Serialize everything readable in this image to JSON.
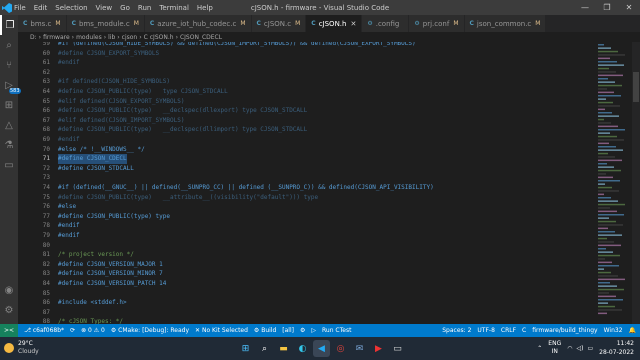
{
  "window": {
    "title": "cJSON.h - firmware - Visual Studio Code",
    "menu": [
      "File",
      "Edit",
      "Selection",
      "View",
      "Go",
      "Run",
      "Terminal",
      "Help"
    ],
    "controls": [
      "—",
      "❐",
      "✕"
    ]
  },
  "tabs": [
    {
      "label": "bms.c",
      "modified": "M",
      "icon": "C"
    },
    {
      "label": "bms_module.c",
      "modified": "M",
      "icon": "C"
    },
    {
      "label": "azure_iot_hub_codec.c",
      "modified": "M",
      "icon": "C"
    },
    {
      "label": "cJSON.c",
      "modified": "M",
      "icon": "C"
    },
    {
      "label": "cJSON.h",
      "modified": "✕",
      "icon": "C"
    },
    {
      "label": ".config",
      "modified": "",
      "icon": "⚙"
    },
    {
      "label": "prj.conf",
      "modified": "M",
      "icon": "⚙"
    },
    {
      "label": "json_common.c",
      "modified": "M",
      "icon": "C"
    }
  ],
  "breadcrumb": [
    "D:",
    "firmware",
    "modules",
    "lib",
    "cjson",
    "C cJSON.h",
    "CJSON_CDECL"
  ],
  "activity_badge": "583",
  "code_lines": [
    {
      "n": "59",
      "t": "#if (defined(CJSON_HIDE_SYMBOLS) && defined(CJSON_IMPORT_SYMBOLS)) && defined(CJSON_EXPORT_SYMBOLS)",
      "cls": "pp"
    },
    {
      "n": "60",
      "t": "#define CJSON_EXPORT_SYMBOLS",
      "cls": "inactive"
    },
    {
      "n": "61",
      "t": "#endif",
      "cls": "inactive"
    },
    {
      "n": "62",
      "t": "",
      "cls": ""
    },
    {
      "n": "63",
      "t": "#if defined(CJSON_HIDE_SYMBOLS)",
      "cls": "inactive"
    },
    {
      "n": "64",
      "t": "#define CJSON_PUBLIC(type)   type CJSON_STDCALL",
      "cls": "inactive"
    },
    {
      "n": "65",
      "t": "#elif defined(CJSON_EXPORT_SYMBOLS)",
      "cls": "inactive"
    },
    {
      "n": "66",
      "t": "#define CJSON_PUBLIC(type)   __declspec(dllexport) type CJSON_STDCALL",
      "cls": "inactive"
    },
    {
      "n": "67",
      "t": "#elif defined(CJSON_IMPORT_SYMBOLS)",
      "cls": "inactive"
    },
    {
      "n": "68",
      "t": "#define CJSON_PUBLIC(type)   __declspec(dllimport) type CJSON_STDCALL",
      "cls": "inactive"
    },
    {
      "n": "69",
      "t": "#endif",
      "cls": "inactive"
    },
    {
      "n": "70",
      "t": "#else /* !__WINDOWS__ */",
      "cls": "pp"
    },
    {
      "n": "71",
      "t": "#define CJSON_CDECL",
      "cls": "sel"
    },
    {
      "n": "72",
      "t": "#define CJSON_STDCALL",
      "cls": "pp"
    },
    {
      "n": "73",
      "t": "",
      "cls": ""
    },
    {
      "n": "74",
      "t": "#if (defined(__GNUC__) || defined(__SUNPRO_CC) || defined (__SUNPRO_C)) && defined(CJSON_API_VISIBILITY)",
      "cls": "pp"
    },
    {
      "n": "75",
      "t": "#define CJSON_PUBLIC(type)   __attribute__((visibility(\"default\"))) type",
      "cls": "inactive"
    },
    {
      "n": "76",
      "t": "#else",
      "cls": "pp"
    },
    {
      "n": "77",
      "t": "#define CJSON_PUBLIC(type) type",
      "cls": "pp"
    },
    {
      "n": "78",
      "t": "#endif",
      "cls": "pp"
    },
    {
      "n": "79",
      "t": "#endif",
      "cls": "pp"
    },
    {
      "n": "80",
      "t": "",
      "cls": ""
    },
    {
      "n": "81",
      "t": "/* project version */",
      "cls": "com"
    },
    {
      "n": "82",
      "t": "#define CJSON_VERSION_MAJOR 1",
      "cls": "pp"
    },
    {
      "n": "83",
      "t": "#define CJSON_VERSION_MINOR 7",
      "cls": "pp"
    },
    {
      "n": "84",
      "t": "#define CJSON_VERSION_PATCH 14",
      "cls": "pp"
    },
    {
      "n": "85",
      "t": "",
      "cls": ""
    },
    {
      "n": "86",
      "t": "#include <stddef.h>",
      "cls": "pp"
    },
    {
      "n": "87",
      "t": "",
      "cls": ""
    },
    {
      "n": "88",
      "t": "/* cJSON Types: */",
      "cls": "com"
    }
  ],
  "statusbar": {
    "remote": "><",
    "left": [
      "⎇ c6af068b*",
      "⟳",
      "⊗ 0 ⚠ 0",
      "⚙ CMake: [Debug]: Ready",
      "✕ No Kit Selected",
      "⚙ Build",
      "[all]",
      "⚙",
      "▷",
      "Run CTest"
    ],
    "right": [
      "Spaces: 2",
      "UTF-8",
      "CRLF",
      "C",
      "firmware/build_thingy",
      "Win32",
      "🔔"
    ]
  },
  "taskbar": {
    "temp": "29°C",
    "weather": "Cloudy",
    "lang": "ENG",
    "region": "IN",
    "time": "11:42",
    "date": "28-07-2022"
  }
}
